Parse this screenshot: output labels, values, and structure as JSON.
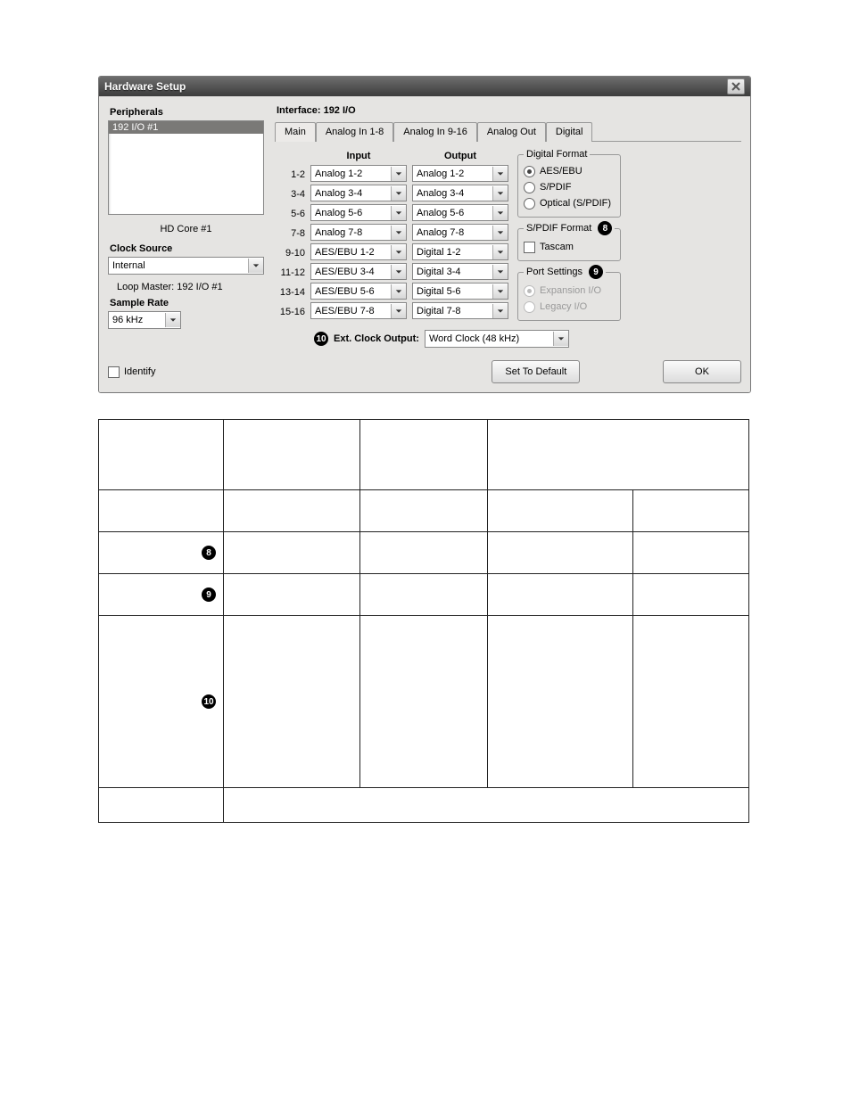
{
  "window": {
    "title": "Hardware Setup"
  },
  "peripherals": {
    "label": "Peripherals",
    "items": [
      "192 I/O #1"
    ],
    "hd_core": "HD Core #1"
  },
  "clock_source": {
    "label": "Clock Source",
    "value": "Internal"
  },
  "loop_master": "Loop Master: 192 I/O #1",
  "sample_rate": {
    "label": "Sample Rate",
    "value": "96 kHz"
  },
  "interface": {
    "label": "Interface:  192 I/O"
  },
  "tabs": [
    "Main",
    "Analog In 1-8",
    "Analog In 9-16",
    "Analog Out",
    "Digital"
  ],
  "io": {
    "input_hdr": "Input",
    "output_hdr": "Output",
    "rows": [
      "1-2",
      "3-4",
      "5-6",
      "7-8",
      "9-10",
      "11-12",
      "13-14",
      "15-16"
    ],
    "inputs": [
      "Analog 1-2",
      "Analog 3-4",
      "Analog 5-6",
      "Analog 7-8",
      "AES/EBU 1-2",
      "AES/EBU 3-4",
      "AES/EBU 5-6",
      "AES/EBU 7-8"
    ],
    "outputs": [
      "Analog 1-2",
      "Analog 3-4",
      "Analog 5-6",
      "Analog 7-8",
      "Digital 1-2",
      "Digital 3-4",
      "Digital 5-6",
      "Digital 7-8"
    ]
  },
  "digital_format": {
    "legend": "Digital Format",
    "options": [
      "AES/EBU",
      "S/PDIF",
      "Optical (S/PDIF)"
    ],
    "selected": "AES/EBU"
  },
  "spdif_format": {
    "legend": "S/PDIF Format",
    "option": "Tascam",
    "badge": "8"
  },
  "port_settings": {
    "legend": "Port Settings",
    "options": [
      "Expansion I/O",
      "Legacy I/O"
    ],
    "badge": "9"
  },
  "ext_clock": {
    "badge": "10",
    "label": "Ext. Clock Output:",
    "value": "Word Clock (48 kHz)"
  },
  "identify_label": "Identify",
  "set_default_label": "Set To Default",
  "ok_label": "OK",
  "lower_badges": {
    "r2": "8",
    "r2b": "9",
    "r3": "10"
  }
}
